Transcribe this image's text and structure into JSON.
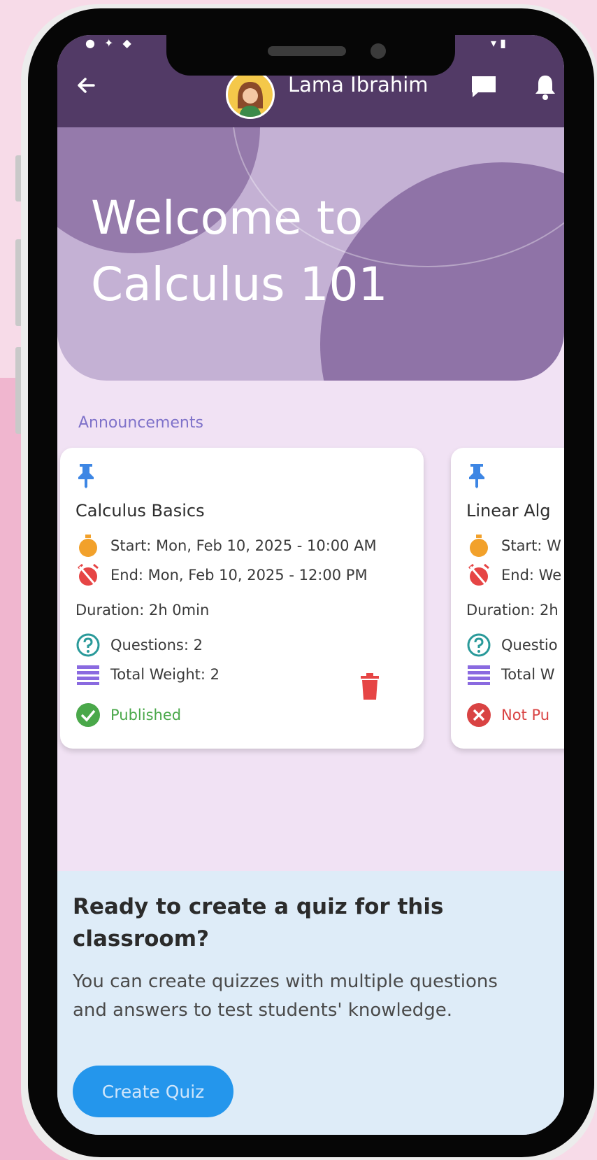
{
  "header": {
    "user_name": "Lama Ibrahim"
  },
  "hero": {
    "title": "Welcome to Calculus 101"
  },
  "announcements": {
    "label": "Announcements",
    "items": [
      {
        "title": "Calculus Basics",
        "start": "Start: Mon, Feb 10, 2025 - 10:00 AM",
        "end": "End: Mon, Feb 10, 2025 - 12:00 PM",
        "duration": "Duration: 2h 0min",
        "questions": "Questions: 2",
        "total_weight": "Total Weight: 2",
        "status": "Published"
      },
      {
        "title": "Linear Alg",
        "start": "Start: W",
        "end": "End: We",
        "duration": "Duration: 2h",
        "questions": "Questio",
        "total_weight": "Total W",
        "status": "Not Pu"
      }
    ]
  },
  "cta": {
    "title": "Ready to create a quiz for this classroom?",
    "text": "You can create quizzes with multiple questions and answers to test students' knowledge.",
    "button_label": "Create Quiz"
  },
  "colors": {
    "appbar": "#523a66",
    "accent_blue": "#2496ec",
    "published": "#4aa84a",
    "not_published": "#d94343",
    "section_label": "#7e71c9"
  }
}
